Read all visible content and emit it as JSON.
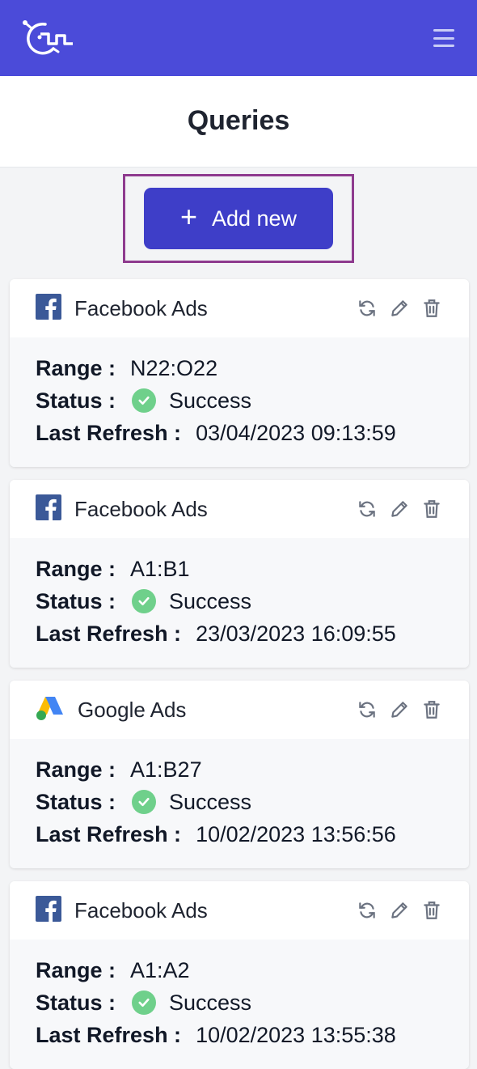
{
  "header": {
    "title": "Queries"
  },
  "actions": {
    "add_label": "Add new"
  },
  "colors": {
    "topbar": "#4b4bd9",
    "button": "#3e3ec8",
    "success": "#6fd08b",
    "highlight": "#8e3a8e"
  },
  "labels": {
    "range": "Range :",
    "status": "Status :",
    "last_refresh": "Last Refresh :"
  },
  "queries": [
    {
      "source": "Facebook Ads",
      "icon": "facebook-icon",
      "range": "N22:O22",
      "status": "Success",
      "last_refresh": "03/04/2023 09:13:59"
    },
    {
      "source": "Facebook Ads",
      "icon": "facebook-icon",
      "range": "A1:B1",
      "status": "Success",
      "last_refresh": "23/03/2023 16:09:55"
    },
    {
      "source": "Google Ads",
      "icon": "google-ads-icon",
      "range": "A1:B27",
      "status": "Success",
      "last_refresh": "10/02/2023 13:56:56"
    },
    {
      "source": "Facebook Ads",
      "icon": "facebook-icon",
      "range": "A1:A2",
      "status": "Success",
      "last_refresh": "10/02/2023 13:55:38"
    }
  ]
}
